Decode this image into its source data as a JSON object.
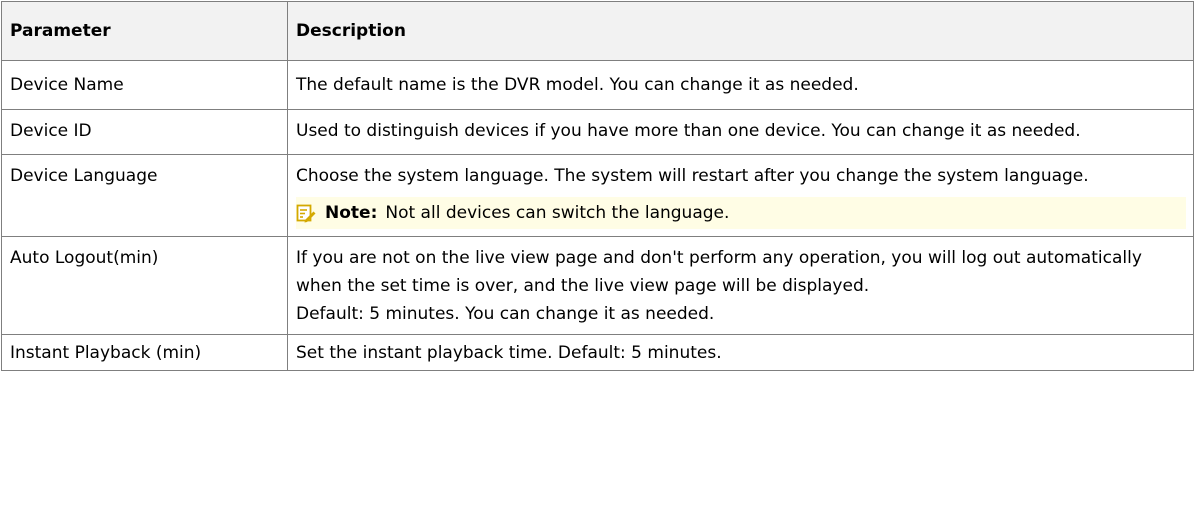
{
  "table": {
    "headers": {
      "parameter": "Parameter",
      "description": "Description"
    },
    "rows": [
      {
        "parameter": "Device Name",
        "description": "The default name is the DVR model. You can change it as needed."
      },
      {
        "parameter": "Device ID",
        "description": "Used to distinguish devices if you have more than one device. You can change it as needed."
      },
      {
        "parameter": "Device Language",
        "description": "Choose the system language. The system will restart after you change the system language.",
        "note": {
          "icon": "note-pencil-icon",
          "label": "Note:",
          "text": "Not all devices can switch the language."
        }
      },
      {
        "parameter": "Auto Logout(min)",
        "description": "If you are not on the live view page and don't perform any operation, you will log out automatically when the set time is over, and the live view page will be displayed.",
        "description_extra": "Default: 5 minutes. You can change it as needed."
      },
      {
        "parameter": "Instant Playback (min)",
        "description": "Set the instant playback time. Default: 5 minutes."
      }
    ]
  },
  "colors": {
    "header_bg": "#f2f2f2",
    "border": "#7f7f7f",
    "note_bg": "#fffde5",
    "note_icon": "#d4a900"
  }
}
